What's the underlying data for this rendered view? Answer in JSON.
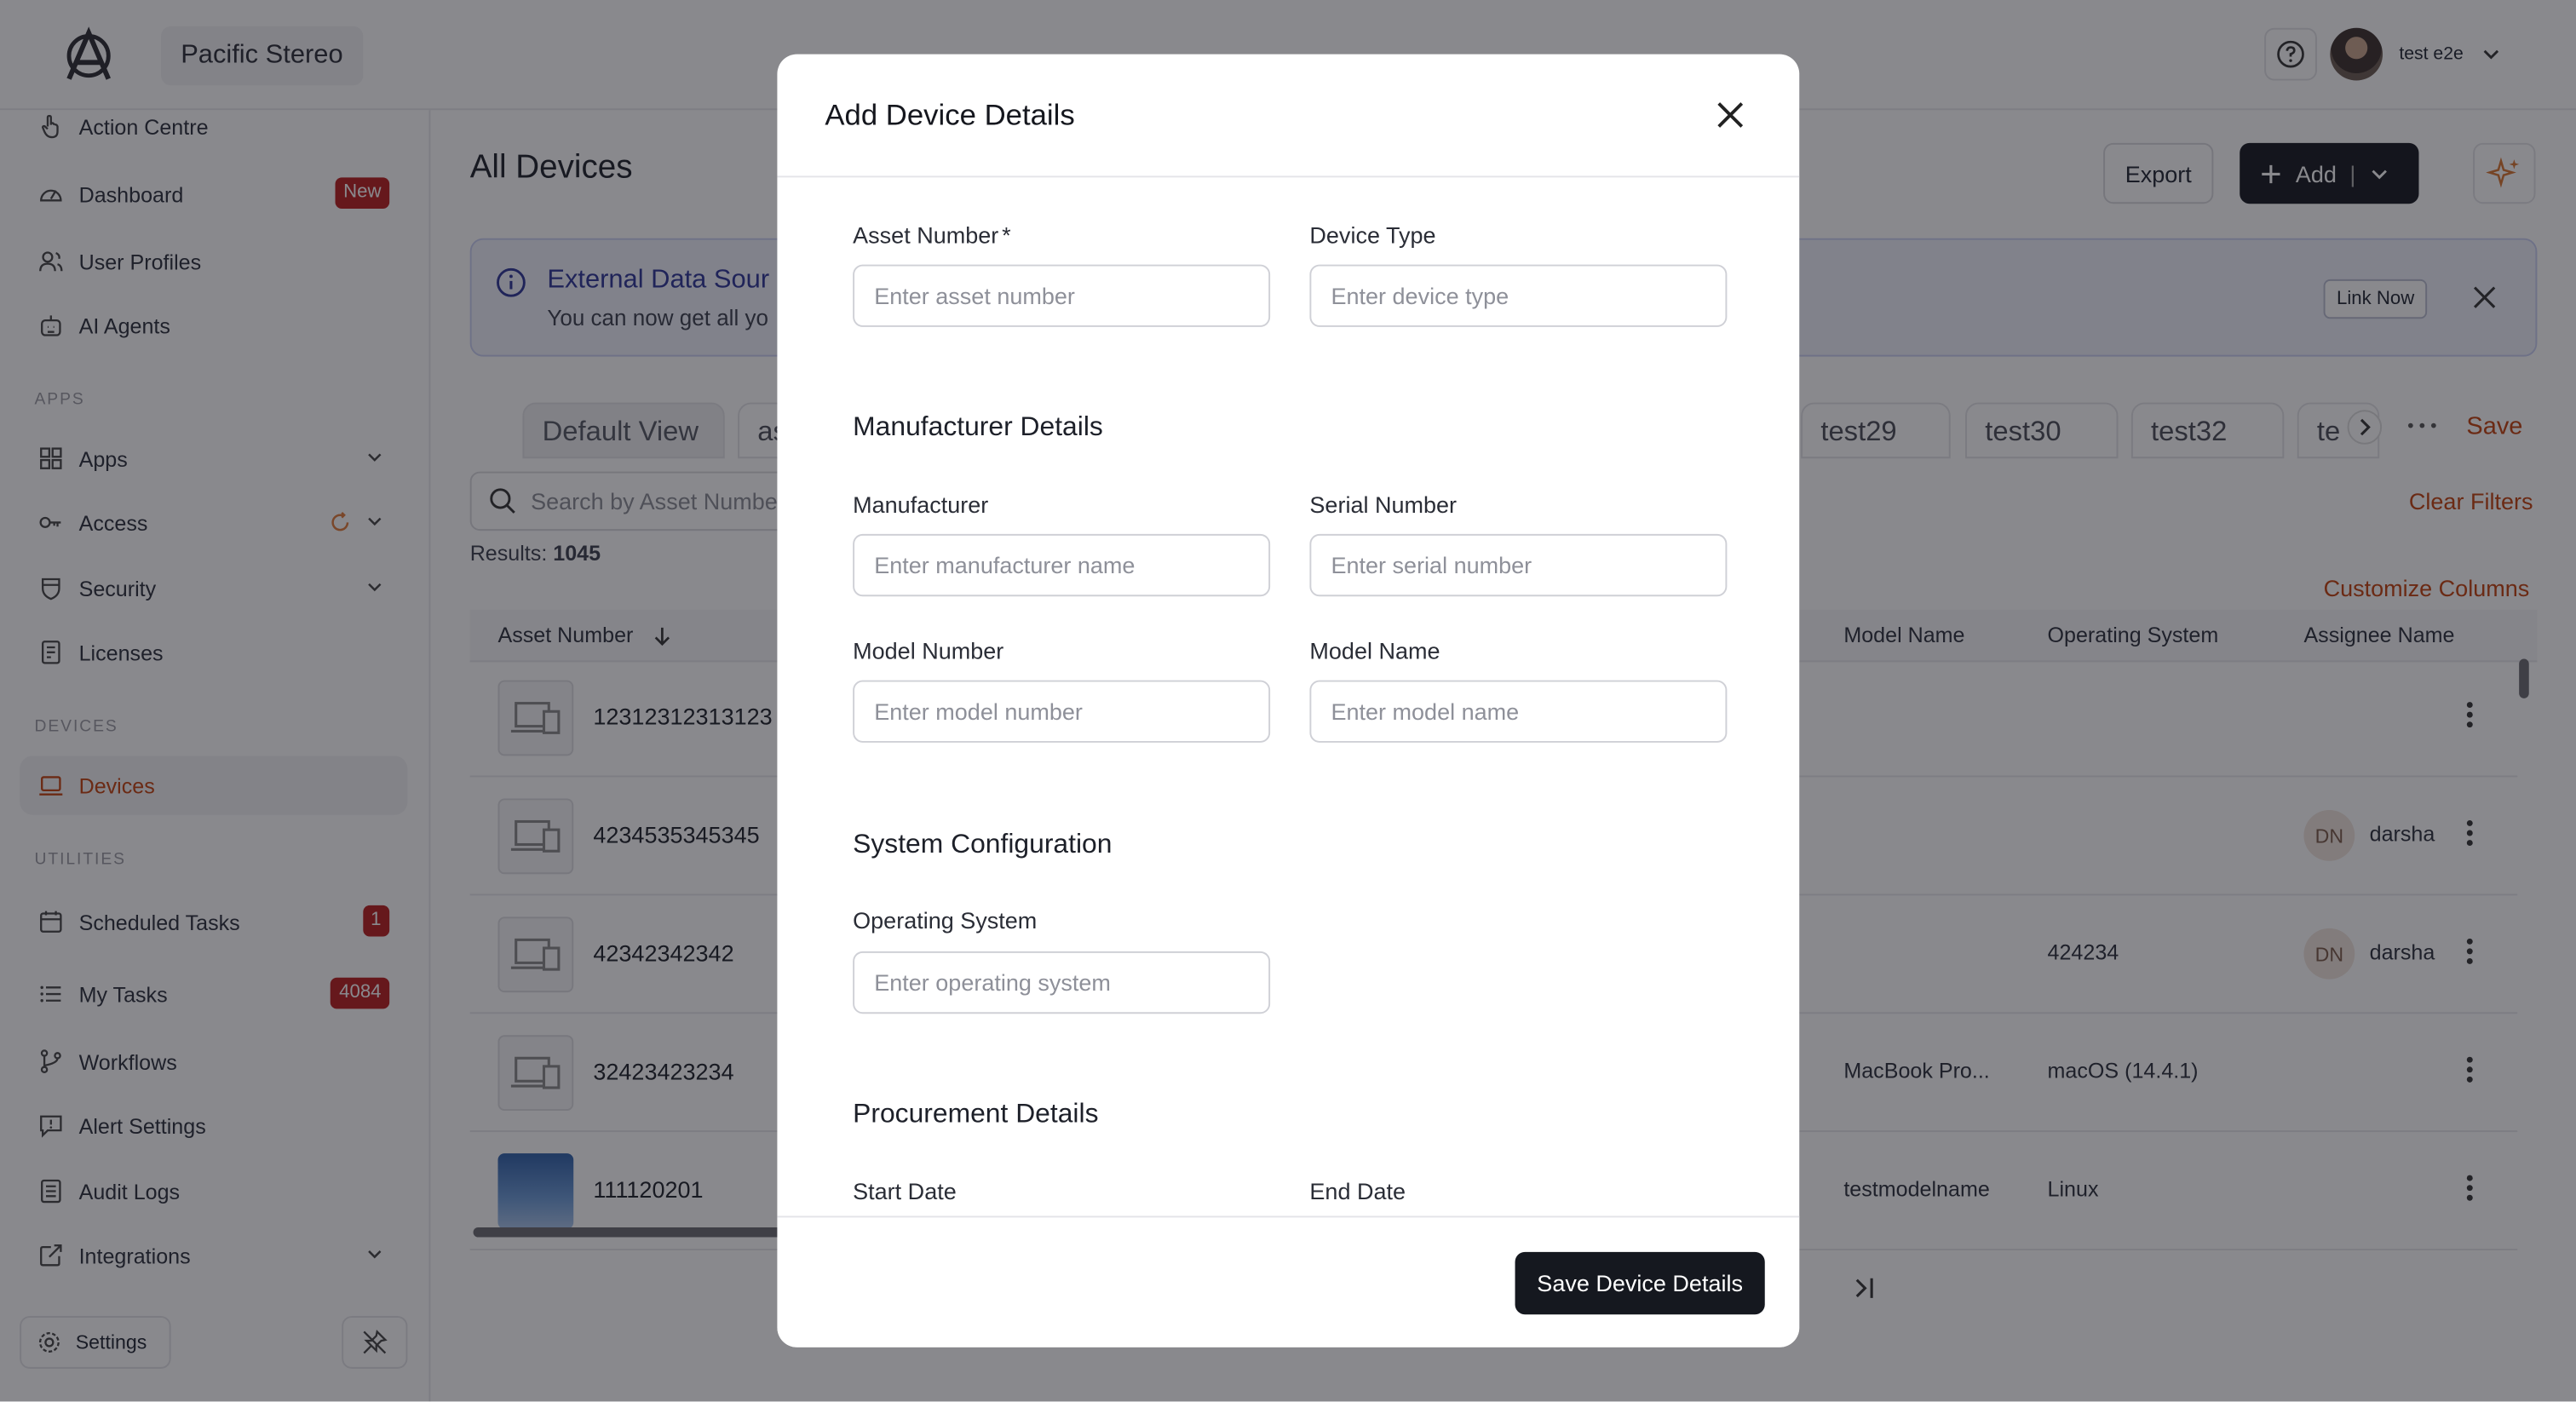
{
  "topbar": {
    "org_name": "Pacific Stereo",
    "user_name": "test e2e"
  },
  "sidebar": {
    "items_top": [
      {
        "label": "Action Centre"
      },
      {
        "label": "Dashboard",
        "badge": "New"
      },
      {
        "label": "User Profiles"
      },
      {
        "label": "AI Agents"
      }
    ],
    "section_apps": "APPS",
    "items_apps": [
      {
        "label": "Apps"
      },
      {
        "label": "Access"
      },
      {
        "label": "Security"
      },
      {
        "label": "Licenses"
      }
    ],
    "section_devices": "DEVICES",
    "devices_label": "Devices",
    "section_utilities": "UTILITIES",
    "items_utilities": [
      {
        "label": "Scheduled Tasks",
        "badge": "1"
      },
      {
        "label": "My Tasks",
        "badge": "4084"
      },
      {
        "label": "Workflows"
      },
      {
        "label": "Alert Settings"
      },
      {
        "label": "Audit Logs"
      },
      {
        "label": "Integrations"
      }
    ],
    "settings_label": "Settings"
  },
  "main": {
    "title": "All Devices",
    "export_label": "Export",
    "add_label": "Add",
    "banner": {
      "title": "External Data Sour",
      "subtitle": "You can now get all yo",
      "link_label": "Link Now"
    },
    "tabs": [
      {
        "label": "Default View"
      },
      {
        "label": "as"
      },
      {
        "label": "test29"
      },
      {
        "label": "test30"
      },
      {
        "label": "test32"
      },
      {
        "label": "te"
      }
    ],
    "save_label": "Save",
    "search_placeholder": "Search by Asset Numbe",
    "clear_filters": "Clear Filters",
    "results_label": "Results:",
    "results_count": "1045",
    "customize_columns": "Customize Columns",
    "columns": [
      "Asset Number",
      "Model Name",
      "Operating System",
      "Assignee Name"
    ],
    "rows": [
      {
        "asset": "12312312313123",
        "model": "",
        "os": "",
        "assignee": "",
        "initials": ""
      },
      {
        "asset": "4234535345345",
        "model": "",
        "os": "",
        "assignee": "darsha",
        "initials": "DN"
      },
      {
        "asset": "42342342342",
        "model": "",
        "os": "424234",
        "assignee": "darsha",
        "initials": "DN"
      },
      {
        "asset": "32423423234",
        "model": "MacBook Pro...",
        "os": "macOS (14.4.1)",
        "assignee": "",
        "initials": ""
      },
      {
        "asset": "111120201",
        "model": "testmodelname",
        "os": "Linux",
        "assignee": "",
        "initials": ""
      }
    ]
  },
  "modal": {
    "title": "Add Device Details",
    "asset_number_label": "Asset Number",
    "required_mark": "*",
    "asset_number_placeholder": "Enter asset number",
    "device_type_label": "Device Type",
    "device_type_placeholder": "Enter device type",
    "manufacturer_section": "Manufacturer Details",
    "manufacturer_label": "Manufacturer",
    "manufacturer_placeholder": "Enter manufacturer name",
    "serial_label": "Serial Number",
    "serial_placeholder": "Enter serial number",
    "model_number_label": "Model Number",
    "model_number_placeholder": "Enter model number",
    "model_name_label": "Model Name",
    "model_name_placeholder": "Enter model name",
    "system_section": "System Configuration",
    "os_label": "Operating System",
    "os_placeholder": "Enter operating system",
    "procurement_section": "Procurement Details",
    "start_date_label": "Start Date",
    "end_date_label": "End Date",
    "save_label": "Save Device Details"
  }
}
